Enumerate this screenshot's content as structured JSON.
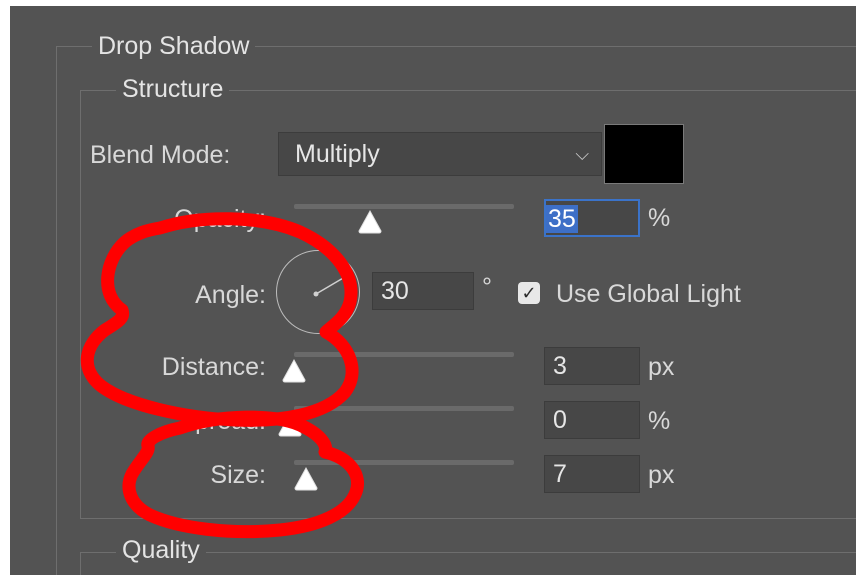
{
  "drop_shadow": {
    "title": "Drop Shadow",
    "structure": {
      "title": "Structure",
      "blend_mode": {
        "label": "Blend Mode:",
        "value": "Multiply",
        "swatch_color": "#000000"
      },
      "opacity": {
        "label": "Opacity:",
        "value": "35",
        "unit": "%",
        "slider_fraction": 0.35
      },
      "angle": {
        "label": "Angle:",
        "value": "30",
        "unit": "°",
        "global_light_label": "Use Global Light",
        "global_light_checked": true
      },
      "distance": {
        "label": "Distance:",
        "value": "3",
        "unit": "px"
      },
      "spread": {
        "label": "Spread:",
        "value": "0",
        "unit": "%"
      },
      "size": {
        "label": "Size:",
        "value": "7",
        "unit": "px"
      }
    },
    "quality": {
      "title": "Quality"
    }
  },
  "annotation_color": "#ff0000",
  "colors": {
    "panel": "#535353",
    "field": "#474747",
    "focus": "#3b73c9"
  }
}
